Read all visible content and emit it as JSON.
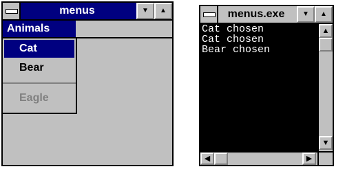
{
  "menus_window": {
    "title": "menus",
    "menu_title": "Animals",
    "items": [
      {
        "label": "Cat",
        "state": "selected"
      },
      {
        "label": "Bear",
        "state": "enabled"
      },
      {
        "label": "Eagle",
        "state": "disabled"
      }
    ]
  },
  "console_window": {
    "title": "menus.exe",
    "lines": [
      "Cat chosen",
      "Cat chosen",
      "Bear chosen"
    ]
  },
  "colors": {
    "active_title": "#000080",
    "face": "#c0c0c0",
    "console_bg": "#000000",
    "console_text": "#ffffff",
    "disabled_text": "#808080"
  },
  "icons": {
    "system_menu": "dash-bar",
    "minimize": "down-triangle",
    "maximize": "up-triangle",
    "scroll_up": "up-arrow",
    "scroll_down": "down-arrow",
    "scroll_left": "left-arrow",
    "scroll_right": "right-arrow"
  }
}
